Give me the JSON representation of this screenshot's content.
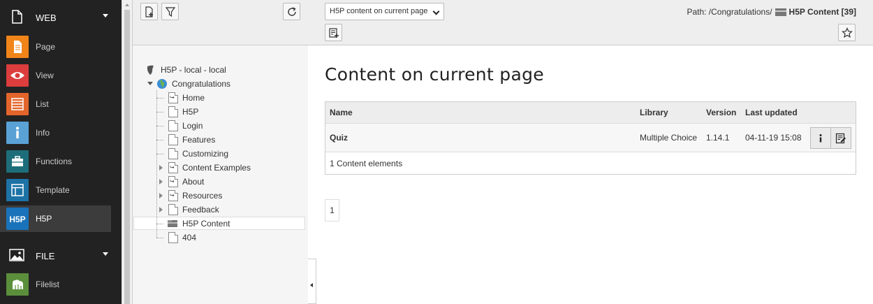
{
  "sidebar": {
    "groups": [
      {
        "label": "WEB",
        "icon": "document-icon"
      },
      {
        "label": "FILE",
        "icon": "image-icon"
      }
    ],
    "items": [
      {
        "label": "Page",
        "icon": "page-icon",
        "color": "#f18519"
      },
      {
        "label": "View",
        "icon": "eye-icon",
        "color": "#dc3d3d"
      },
      {
        "label": "List",
        "icon": "list-icon",
        "color": "#e3652c"
      },
      {
        "label": "Info",
        "icon": "info-icon",
        "color": "#5aa2d6"
      },
      {
        "label": "Functions",
        "icon": "briefcase-icon",
        "color": "#1d6e7a"
      },
      {
        "label": "Template",
        "icon": "template-icon",
        "color": "#1d72a6"
      },
      {
        "label": "H5P",
        "icon": "h5p-icon",
        "color": "#1a73ba"
      },
      {
        "label": "Filelist",
        "icon": "filelist-icon",
        "color": "#5b8f3c"
      }
    ],
    "h5p_logo_text": "H5P"
  },
  "tree": {
    "root": "H5P - local - local",
    "site": "Congratulations",
    "pages": [
      {
        "label": "Home",
        "type": "shortcut",
        "expandable": false
      },
      {
        "label": "H5P",
        "type": "page",
        "expandable": false
      },
      {
        "label": "Login",
        "type": "page",
        "expandable": false
      },
      {
        "label": "Features",
        "type": "page",
        "expandable": false
      },
      {
        "label": "Customizing",
        "type": "page",
        "expandable": false
      },
      {
        "label": "Content Examples",
        "type": "shortcut",
        "expandable": true
      },
      {
        "label": "About",
        "type": "shortcut",
        "expandable": true
      },
      {
        "label": "Resources",
        "type": "shortcut",
        "expandable": true
      },
      {
        "label": "Feedback",
        "type": "page",
        "expandable": true
      },
      {
        "label": "H5P Content",
        "type": "folder",
        "expandable": false,
        "selected": true
      },
      {
        "label": "404",
        "type": "page",
        "expandable": false
      }
    ]
  },
  "header": {
    "view_select": "H5P content on current page",
    "path_prefix": "Path: /Congratulations/",
    "path_current": "H5P Content [39]"
  },
  "main": {
    "title": "Content on current page",
    "table": {
      "columns": [
        "Name",
        "Library",
        "Version",
        "Last updated"
      ],
      "rows": [
        {
          "name": "Quiz",
          "library": "Multiple Choice",
          "version": "1.14.1",
          "updated": "04-11-19 15:08"
        }
      ],
      "footer": "1 Content elements"
    },
    "pager": "1"
  }
}
